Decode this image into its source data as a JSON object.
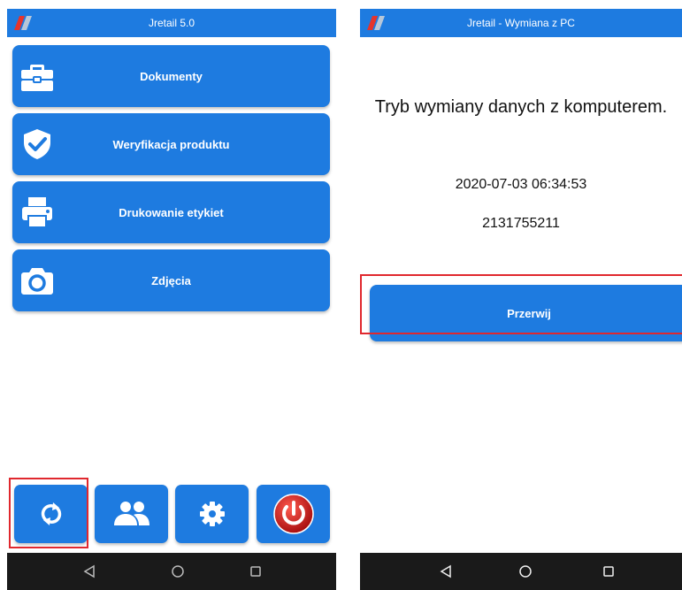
{
  "colors": {
    "primary": "#1e7be0",
    "highlight": "#e0282e",
    "navbar": "#1a1a1a",
    "power": "#d11c1c"
  },
  "left_screen": {
    "title": "Jretail 5.0",
    "menu": [
      {
        "label": "Dokumenty",
        "icon": "briefcase-icon"
      },
      {
        "label": "Weryfikacja produktu",
        "icon": "shield-check-icon"
      },
      {
        "label": "Drukowanie etykiet",
        "icon": "printer-icon"
      },
      {
        "label": "Zdjęcia",
        "icon": "camera-icon"
      }
    ],
    "bottom_bar": [
      {
        "icon": "sync-icon"
      },
      {
        "icon": "users-icon"
      },
      {
        "icon": "gear-icon"
      },
      {
        "icon": "power-icon"
      }
    ]
  },
  "right_screen": {
    "title": "Jretail - Wymiana z PC",
    "mode_text": "Tryb wymiany danych z komputerem.",
    "datetime": "2020-07-03 06:34:53",
    "code": "2131755211",
    "action_label": "Przerwij"
  },
  "nav": {
    "back_icon": "back-triangle-icon",
    "home_icon": "home-circle-icon",
    "recents_icon": "recents-square-icon"
  }
}
